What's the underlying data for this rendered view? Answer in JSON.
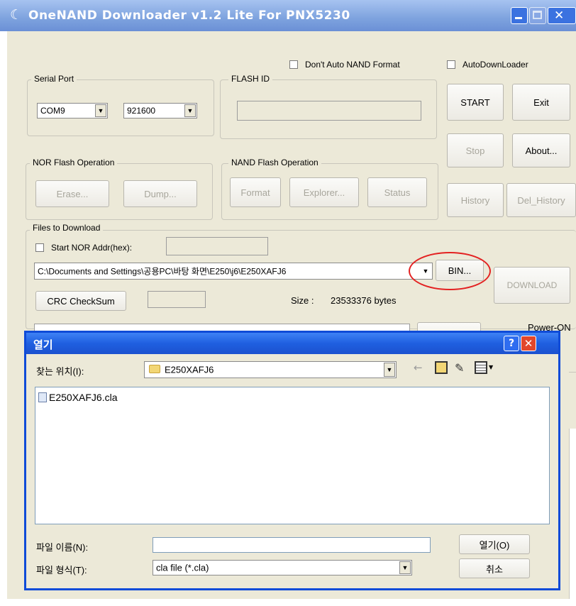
{
  "window": {
    "title": "OneNAND Downloader v1.2 Lite For PNX5230"
  },
  "options": {
    "dont_auto_nand_format": "Don't Auto NAND Format",
    "auto_downloader": "AutoDownLoader"
  },
  "serial_port": {
    "label": "Serial Port",
    "port": "COM9",
    "baud": "921600"
  },
  "flash_id": {
    "label": "FLASH ID",
    "value": ""
  },
  "buttons": {
    "start": "START",
    "exit": "Exit",
    "stop": "Stop",
    "about": "About...",
    "history": "History",
    "del_history": "Del_History"
  },
  "nor": {
    "label": "NOR Flash Operation",
    "erase": "Erase...",
    "dump": "Dump..."
  },
  "nand": {
    "label": "NAND Flash Operation",
    "format": "Format",
    "explorer": "Explorer...",
    "status": "Status"
  },
  "files": {
    "label": "Files to Download",
    "start_nor_addr": "Start NOR Addr(hex):",
    "path": "C:\\Documents and Settings\\공용PC\\바탕 화면\\E250\\j6\\E250XAFJ6",
    "bin": "BIN...",
    "download": "DOWNLOAD",
    "crc": "CRC CheckSum",
    "size_label": "Size :",
    "size_value": "23533376 bytes",
    "power_on": "Power-ON"
  },
  "dialog": {
    "title": "열기",
    "look_in_label": "찾는 위치(I):",
    "look_in_value": "E250XAFJ6",
    "files": [
      "E250XAFJ6.cla"
    ],
    "filename_label": "파일 이름(N):",
    "filename_value": "",
    "filetype_label": "파일 형식(T):",
    "filetype_value": "cla file (*.cla)",
    "open_button": "열기(O)",
    "cancel_button": "취소"
  }
}
